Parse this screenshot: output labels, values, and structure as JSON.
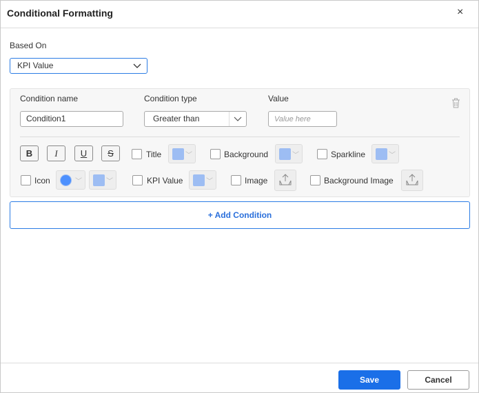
{
  "dialog": {
    "title": "Conditional Formatting",
    "close": "×"
  },
  "based_on": {
    "label": "Based On",
    "value": "KPI Value"
  },
  "condition": {
    "name_label": "Condition name",
    "name_value": "Condition1",
    "type_label": "Condition type",
    "type_value": "Greater than",
    "value_label": "Value",
    "value_placeholder": "Value here",
    "bold": "B",
    "italic": "I",
    "underline": "U",
    "strike": "S",
    "title": "Title",
    "background": "Background",
    "sparkline": "Sparkline",
    "icon": "Icon",
    "kpi_value": "KPI Value",
    "image": "Image",
    "background_image": "Background Image"
  },
  "add_condition": "+ Add Condition",
  "footer": {
    "save": "Save",
    "cancel": "Cancel"
  },
  "colors": {
    "accent": "#1a6fe8",
    "swatch": "#9dbdf3"
  }
}
